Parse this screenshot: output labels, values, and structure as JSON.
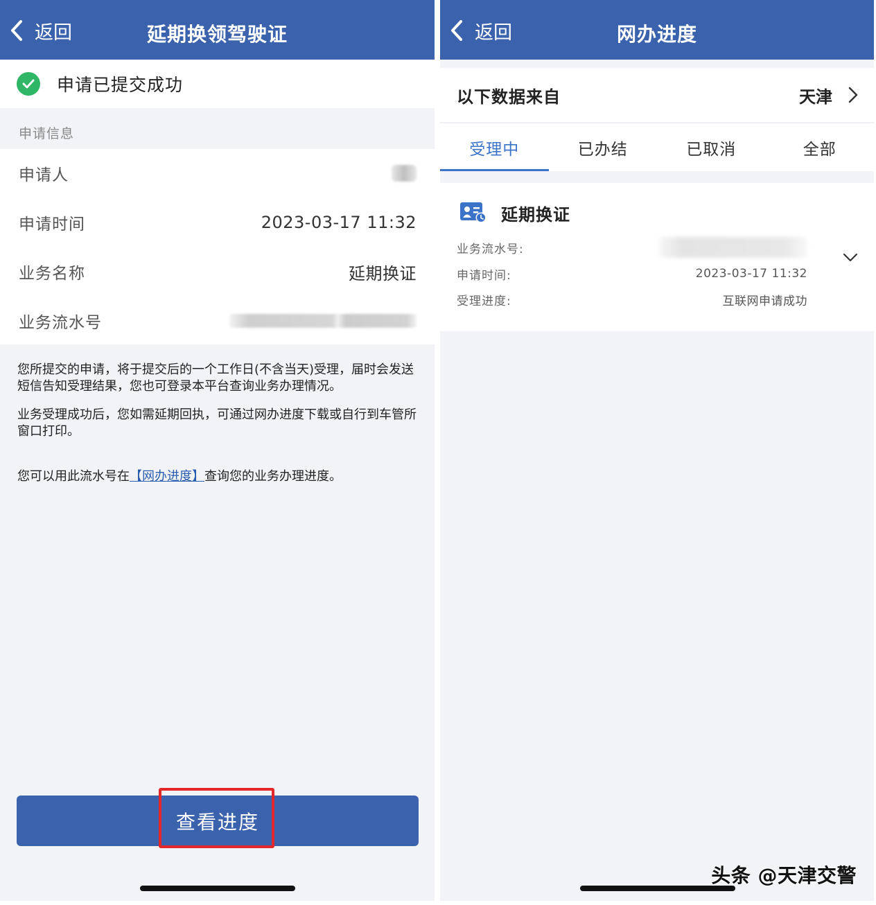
{
  "left": {
    "nav": {
      "back_label": "返回",
      "title": "延期换领驾驶证"
    },
    "success_text": "申请已提交成功",
    "section_label": "申请信息",
    "fields": [
      {
        "label": "申请人",
        "value": ""
      },
      {
        "label": "申请时间",
        "value": "2023-03-17 11:32"
      },
      {
        "label": "业务名称",
        "value": "延期换证"
      },
      {
        "label": "业务流水号",
        "value": ""
      }
    ],
    "notes": {
      "p1": "您所提交的申请，将于提交后的一个工作日(不含当天)受理，届时会发送短信告知受理结果，您也可登录本平台查询业务办理情况。",
      "p2": "业务受理成功后，您如需延期回执，可通过网办进度下载或自行到车管所窗口打印。",
      "p3_before": "您可以用此流水号在",
      "p3_link": "【网办进度】",
      "p3_after": "查询您的业务办理进度。"
    },
    "button_label": "查看进度"
  },
  "right": {
    "nav": {
      "back_label": "返回",
      "title": "网办进度"
    },
    "source_label": "以下数据来自",
    "source_city": "天津",
    "tabs": [
      "受理中",
      "已办结",
      "已取消",
      "全部"
    ],
    "active_tab": 0,
    "card": {
      "title": "延期换证",
      "rows": [
        {
          "label": "业务流水号:",
          "value": ""
        },
        {
          "label": "申请时间:",
          "value": "2023-03-17 11:32"
        },
        {
          "label": "受理进度:",
          "value": "互联网申请成功"
        }
      ]
    }
  },
  "watermark": "头条 @天津交警",
  "colors": {
    "nav_blue": "#3b62ac",
    "tab_active": "#3b73c9",
    "success_green": "#2fb767",
    "highlight_red": "#e3262a"
  },
  "icons": [
    "chevron-left-icon",
    "check-circle-icon",
    "chevron-right-icon",
    "id-card-icon",
    "chevron-down-icon"
  ]
}
